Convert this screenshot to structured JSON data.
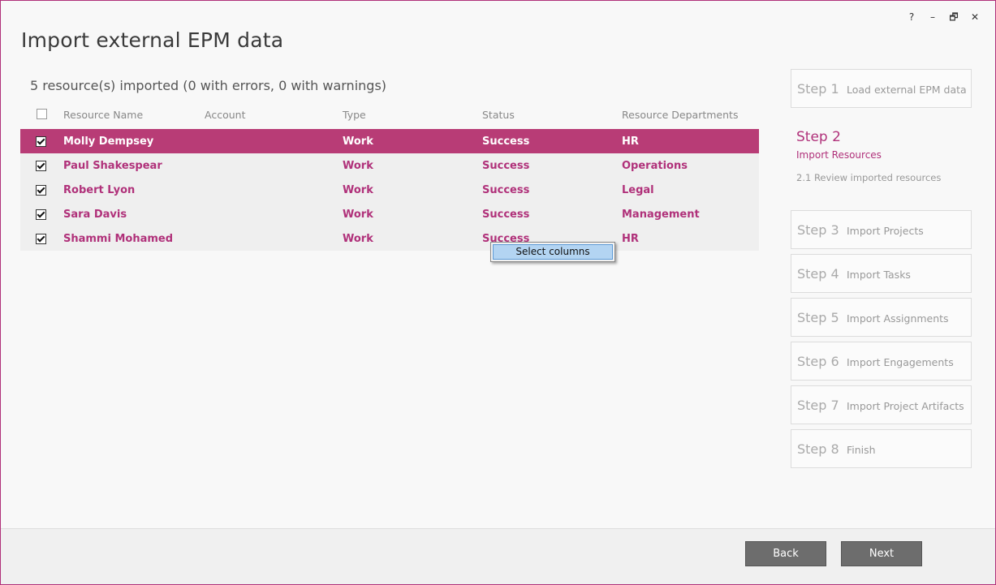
{
  "window": {
    "title": "Import external EPM data",
    "controls": {
      "help": "?",
      "minimize": "–",
      "restore": "🗗",
      "close": "✕"
    }
  },
  "summary": "5 resource(s) imported (0 with errors, 0 with warnings)",
  "grid": {
    "columns": {
      "name": "Resource Name",
      "account": "Account",
      "type": "Type",
      "status": "Status",
      "departments": "Resource Departments"
    },
    "rows": [
      {
        "name": "Molly Dempsey",
        "account": "",
        "type": "Work",
        "status": "Success",
        "department": "HR",
        "checked": true,
        "selected": true
      },
      {
        "name": "Paul Shakespear",
        "account": "",
        "type": "Work",
        "status": "Success",
        "department": "Operations",
        "checked": true,
        "selected": false
      },
      {
        "name": "Robert Lyon",
        "account": "",
        "type": "Work",
        "status": "Success",
        "department": "Legal",
        "checked": true,
        "selected": false
      },
      {
        "name": "Sara Davis",
        "account": "",
        "type": "Work",
        "status": "Success",
        "department": "Management",
        "checked": true,
        "selected": false
      },
      {
        "name": "Shammi Mohamed",
        "account": "",
        "type": "Work",
        "status": "Success",
        "department": "HR",
        "checked": true,
        "selected": false
      }
    ]
  },
  "context_menu": {
    "item": "Select columns"
  },
  "steps": {
    "step1": {
      "num": "Step 1",
      "label": "Load external EPM data"
    },
    "step2": {
      "num": "Step 2",
      "label": "Import Resources",
      "sub": "2.1 Review imported resources"
    },
    "step3": {
      "num": "Step 3",
      "label": "Import Projects"
    },
    "step4": {
      "num": "Step 4",
      "label": "Import Tasks"
    },
    "step5": {
      "num": "Step 5",
      "label": "Import Assignments"
    },
    "step6": {
      "num": "Step 6",
      "label": "Import Engagements"
    },
    "step7": {
      "num": "Step 7",
      "label": "Import Project Artifacts"
    },
    "step8": {
      "num": "Step 8",
      "label": "Finish"
    }
  },
  "footer": {
    "back": "Back",
    "next": "Next"
  },
  "colors": {
    "accent": "#b0317a",
    "selected_row": "#b83c76",
    "button": "#6d6d6d"
  }
}
